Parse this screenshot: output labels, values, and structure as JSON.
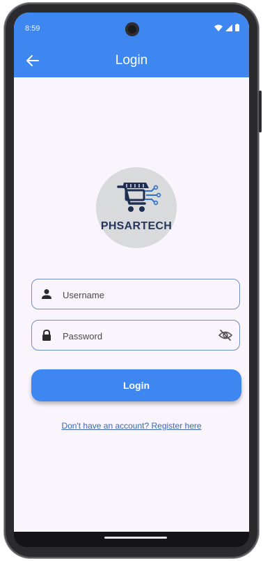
{
  "status_bar": {
    "time": "8:59"
  },
  "app_bar": {
    "title": "Login"
  },
  "logo": {
    "text": "PHSARTECH"
  },
  "username_field": {
    "placeholder": "Username",
    "value": ""
  },
  "password_field": {
    "placeholder": "Password",
    "value": ""
  },
  "login_button": {
    "label": "Login"
  },
  "register_link": {
    "text": "Don't have an account? Register here"
  },
  "colors": {
    "primary": "#3f87f0",
    "background": "#faf4fc",
    "field_border": "#6e8fbf",
    "logo_circle": "#d9dadb",
    "logo_text": "#23375e"
  },
  "icons": {
    "back": "arrow-left-icon",
    "username": "person-icon",
    "password": "lock-icon",
    "visibility": "eye-off-icon",
    "logo": "shopping-cart-icon"
  }
}
